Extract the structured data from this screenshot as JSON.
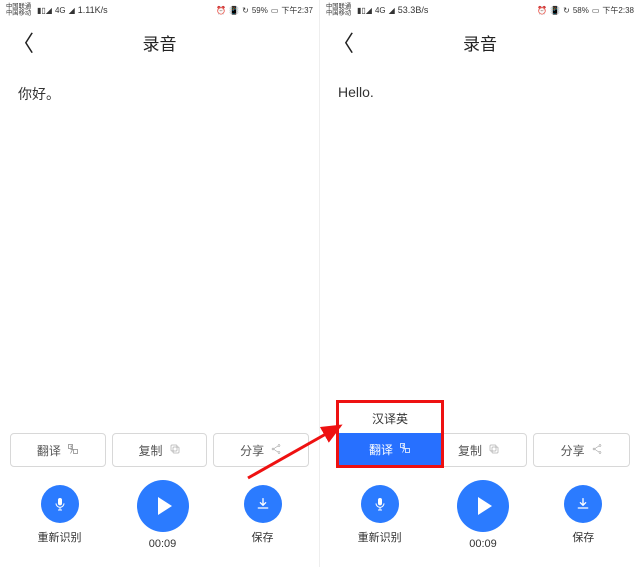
{
  "left": {
    "status": {
      "carrier1": "中国联通",
      "carrier2": "中国移动",
      "netlabel": "4G",
      "speed": "1.11K/s",
      "battery": "59%",
      "time": "下午2:37"
    },
    "nav": {
      "title": "录音"
    },
    "content": "你好。",
    "actions": {
      "translate": "翻译",
      "copy": "复制",
      "share": "分享"
    },
    "bottom": {
      "rerecognize": "重新识别",
      "time": "00:09",
      "save": "保存"
    }
  },
  "right": {
    "status": {
      "carrier1": "中国联通",
      "carrier2": "中国移动",
      "netlabel": "4G",
      "speed": "53.3B/s",
      "battery": "58%",
      "time": "下午2:38"
    },
    "nav": {
      "title": "录音"
    },
    "content": "Hello.",
    "popup": {
      "option": "汉译英",
      "selected": "翻译"
    },
    "actions": {
      "copy": "复制",
      "share": "分享"
    },
    "bottom": {
      "rerecognize": "重新识别",
      "time": "00:09",
      "save": "保存"
    }
  },
  "colors": {
    "accent": "#2b7bff",
    "highlight": "#e11"
  }
}
